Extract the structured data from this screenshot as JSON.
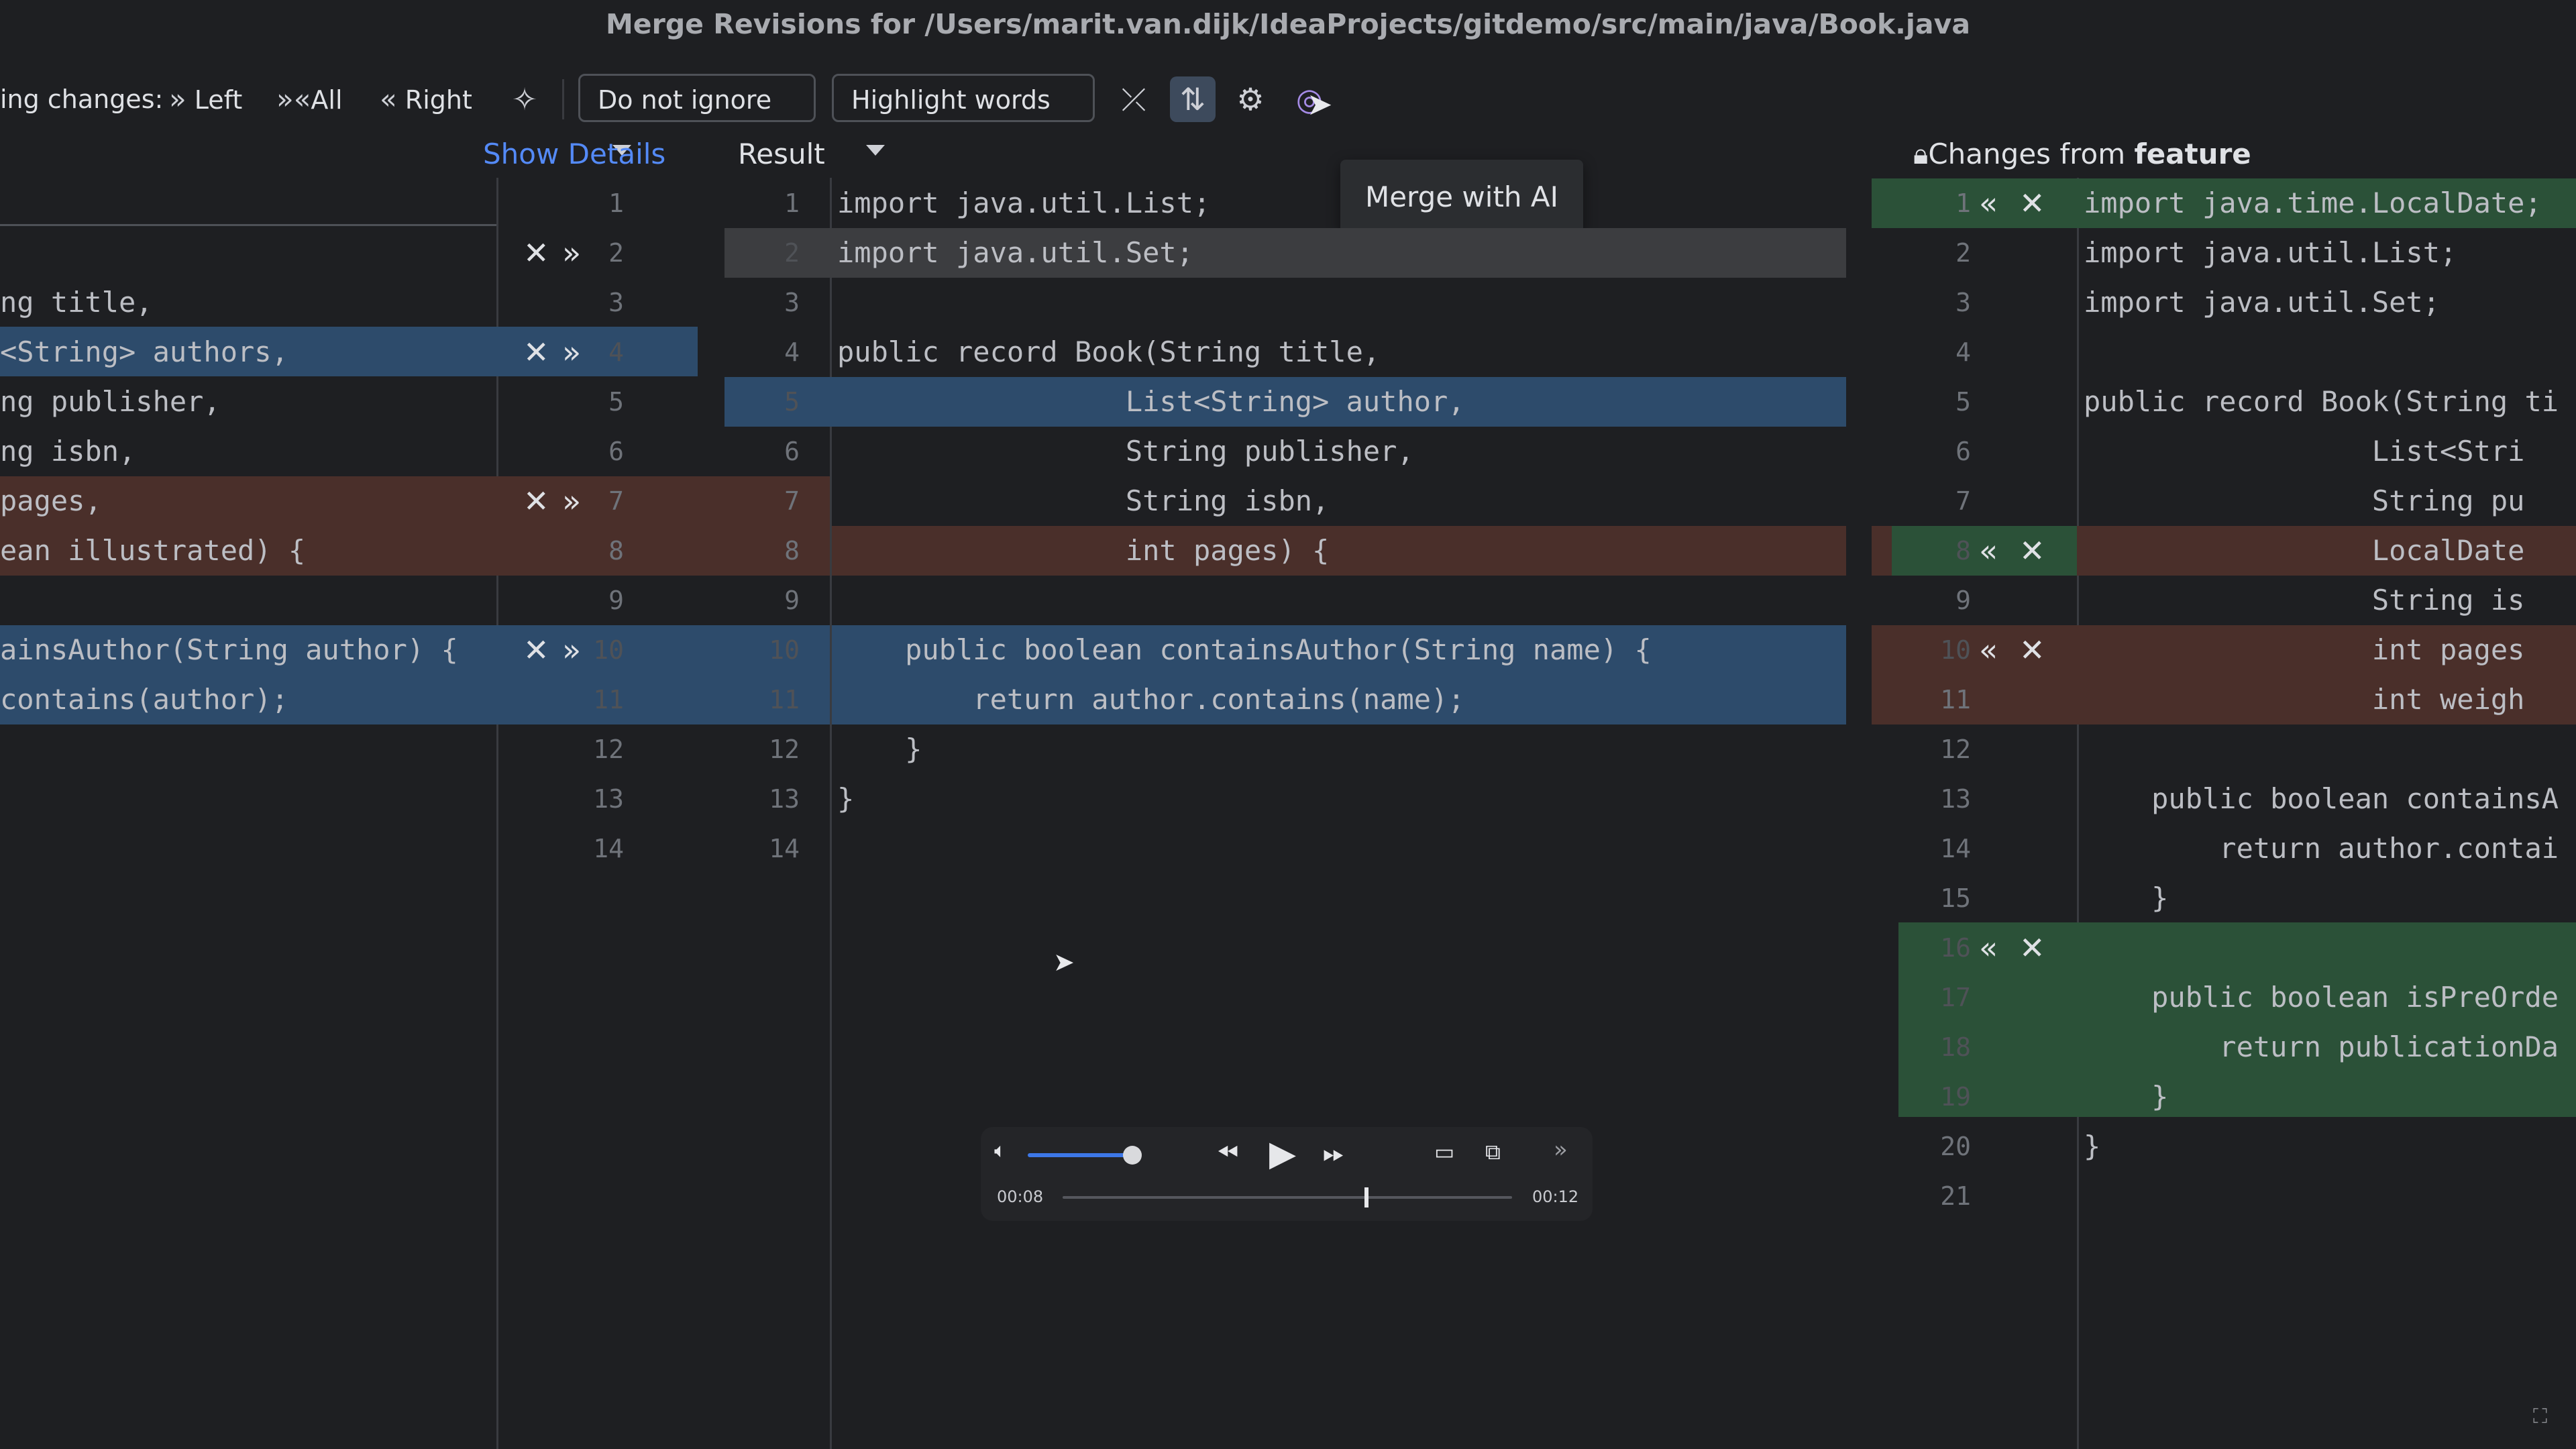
{
  "window": {
    "title": "Merge Revisions for /Users/marit.van.dijk/IdeaProjects/gitdemo/src/main/java/Book.java"
  },
  "toolbar": {
    "apply_label": "ing changes:",
    "left_label": "Left",
    "all_label": "All",
    "right_label": "Right",
    "ignore_dropdown": "Do not ignore",
    "highlight_dropdown": "Highlight words",
    "tooltip": "Merge with AI"
  },
  "headers": {
    "show_details": "Show Details",
    "result": "Result",
    "changes_from": "Changes from",
    "branch": "feature"
  },
  "left_lines": [
    {
      "text": ""
    },
    {
      "text": ""
    },
    {
      "text": "ng title,"
    },
    {
      "text": "<String> authors,"
    },
    {
      "text": "ng publisher,"
    },
    {
      "text": "ng isbn,"
    },
    {
      "text": "pages,"
    },
    {
      "text": "ean illustrated) {"
    },
    {
      "text": ""
    },
    {
      "text": "ainsAuthor(String author) {"
    },
    {
      "text": "contains(author);"
    }
  ],
  "left_numbers": [
    "1",
    "2",
    "3",
    "4",
    "5",
    "6",
    "7",
    "8",
    "9",
    "10",
    "11",
    "12",
    "13",
    "14"
  ],
  "result_numbers": [
    "1",
    "2",
    "3",
    "4",
    "5",
    "6",
    "7",
    "8",
    "9",
    "10",
    "11",
    "12",
    "13",
    "14"
  ],
  "result_lines": [
    "import java.util.List;",
    "import java.util.Set;",
    "",
    "public record Book(String title,",
    "                 List<String> author,",
    "                 String publisher,",
    "                 String isbn,",
    "                 int pages) {",
    "",
    "    public boolean containsAuthor(String name) {",
    "        return author.contains(name);",
    "    }",
    "}",
    ""
  ],
  "right_numbers": [
    "1",
    "2",
    "3",
    "4",
    "5",
    "6",
    "7",
    "8",
    "9",
    "10",
    "11",
    "12",
    "13",
    "14",
    "15",
    "16",
    "17",
    "18",
    "19",
    "20",
    "21"
  ],
  "right_lines": [
    "import java.time.LocalDate;",
    "import java.util.List;",
    "import java.util.Set;",
    "",
    "public record Book(String ti",
    "                 List<Stri",
    "                 String pu",
    "                 LocalDate",
    "                 String is",
    "                 int pages",
    "                 int weigh",
    "",
    "    public boolean containsA",
    "        return author.contai",
    "    }",
    "",
    "    public boolean isPreOrde",
    "        return publicationDa",
    "    }",
    "}",
    ""
  ],
  "player": {
    "elapsed": "00:08",
    "total": "00:12",
    "volume": 0.85,
    "progress": 0.67
  },
  "colors": {
    "accent": "#548af7",
    "modified": "#2d4b6b",
    "conflict": "#4a2f2a",
    "added": "#2b5138"
  }
}
